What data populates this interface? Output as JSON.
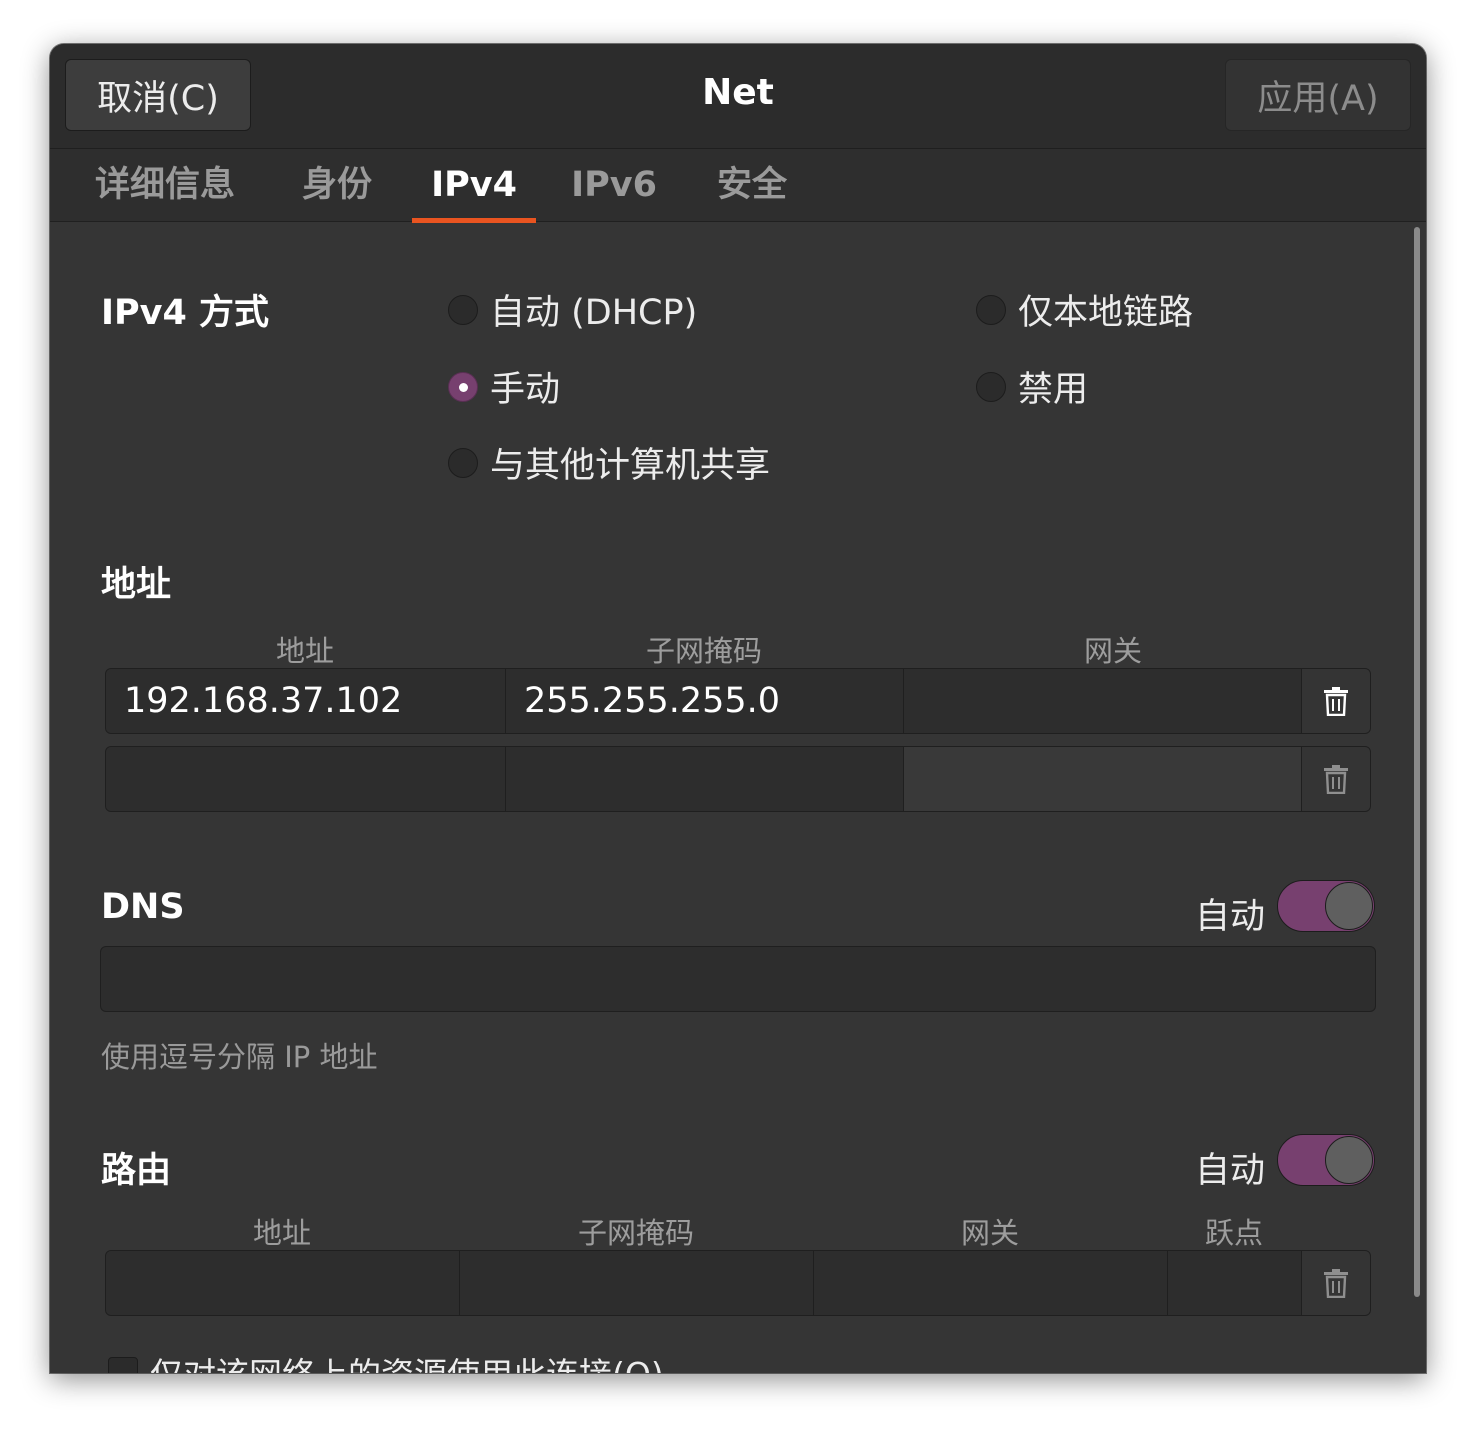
{
  "header": {
    "cancel_label": "取消(C)",
    "title": "Net",
    "apply_label": "应用(A)"
  },
  "tabs": [
    {
      "label": "详细信息",
      "active": false
    },
    {
      "label": "身份",
      "active": false
    },
    {
      "label": "IPv4",
      "active": true
    },
    {
      "label": "IPv6",
      "active": false
    },
    {
      "label": "安全",
      "active": false
    }
  ],
  "ipv4_method": {
    "title": "IPv4 方式",
    "options": [
      {
        "label": "自动 (DHCP)",
        "checked": false
      },
      {
        "label": "仅本地链路",
        "checked": false
      },
      {
        "label": "手动",
        "checked": true
      },
      {
        "label": "禁用",
        "checked": false
      },
      {
        "label": "与其他计算机共享",
        "checked": false
      }
    ]
  },
  "addresses": {
    "title": "地址",
    "columns": [
      "地址",
      "子网掩码",
      "网关"
    ],
    "rows": [
      {
        "address": "192.168.37.102",
        "netmask": "255.255.255.0",
        "gateway": ""
      },
      {
        "address": "",
        "netmask": "",
        "gateway": ""
      }
    ]
  },
  "dns": {
    "title": "DNS",
    "auto_label": "自动",
    "auto_enabled": true,
    "value": "",
    "hint": "使用逗号分隔 IP 地址"
  },
  "routes": {
    "title": "路由",
    "auto_label": "自动",
    "auto_enabled": true,
    "columns": [
      "地址",
      "子网掩码",
      "网关",
      "跃点"
    ],
    "rows": [
      {
        "address": "",
        "netmask": "",
        "gateway": "",
        "metric": ""
      }
    ]
  },
  "only_local_resources": {
    "label": "仅对该网络上的资源使用此连接(O)",
    "checked": false
  },
  "icons": {
    "delete": "trash-icon"
  },
  "colors": {
    "accent": "#e95420",
    "selection": "#77406f",
    "background": "#353535"
  }
}
